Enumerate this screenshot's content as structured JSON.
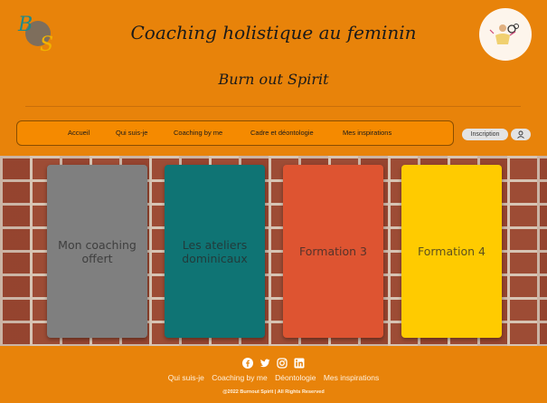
{
  "header": {
    "logo_text": "BS",
    "title": "Coaching holistique au feminin",
    "subtitle": "Burn out Spirit"
  },
  "nav": {
    "items": [
      "Accueil",
      "Qui suis-je",
      "Coaching by me",
      "Cadre et déontologie",
      "Mes inspirations"
    ],
    "signup_label": "Inscription",
    "account_icon": "user-icon"
  },
  "cards": [
    {
      "label": "Mon coaching offert",
      "color": "#7F7F7F"
    },
    {
      "label": "Les ateliers dominicaux",
      "color": "#0F7474"
    },
    {
      "label": "Formation 3",
      "color": "#DE5431"
    },
    {
      "label": "Formation 4",
      "color": "#FFCB00"
    }
  ],
  "footer": {
    "social_icons": [
      "facebook-icon",
      "twitter-icon",
      "instagram-icon",
      "linkedin-icon"
    ],
    "links": [
      "Qui suis-je",
      "Coaching by me",
      "Déontologie",
      "Mes inspirations"
    ],
    "copyright": "@2022 Burnout Spirit | All Rights Reserved"
  },
  "colors": {
    "page_background": "#E8830A",
    "nav_background": "#F58A00",
    "footer_text": "#FFF2E0"
  }
}
